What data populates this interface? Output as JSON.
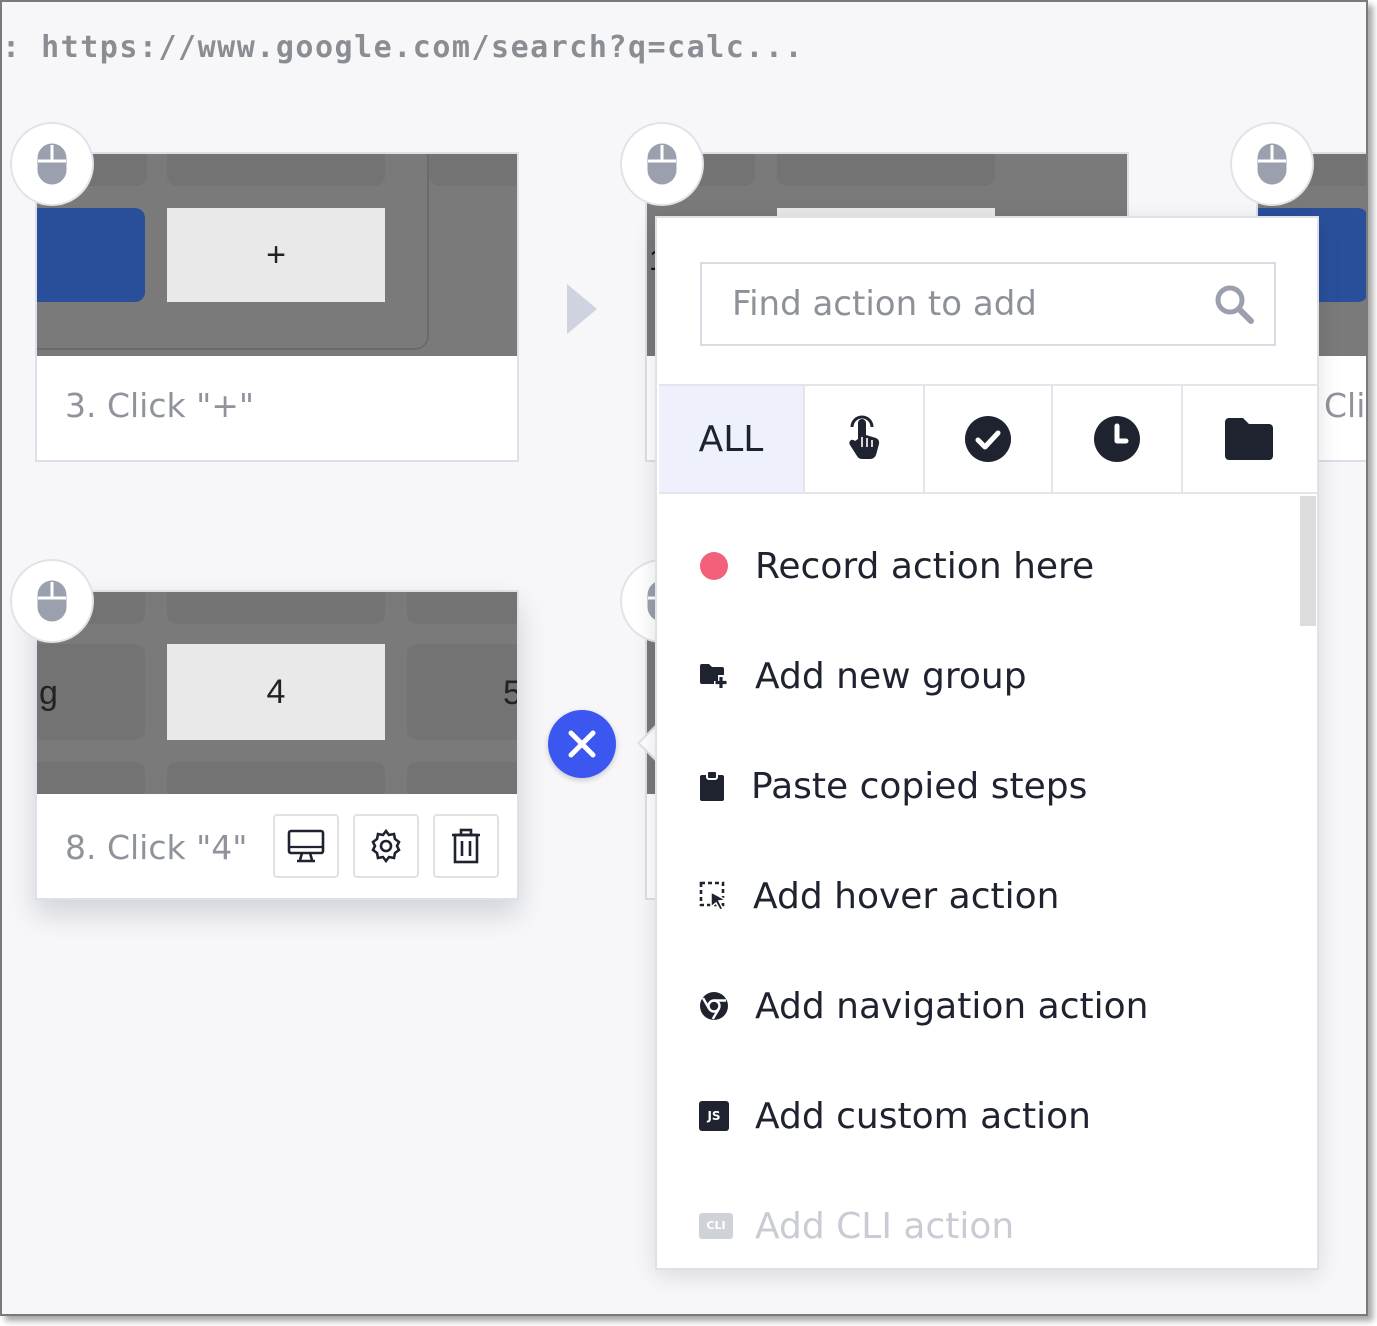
{
  "url_bar": {
    "text": ": https://www.google.com/search?q=calc..."
  },
  "steps": [
    {
      "caption": "3. Click \"+\"",
      "key_label": "+"
    },
    {
      "caption": "8. Click \"4\"",
      "key_label": "4",
      "side_left": "g",
      "side_right": "5"
    }
  ],
  "partial_caption_right": "Cli",
  "partial_key_label": "1",
  "step_tools": {
    "screen": "desktop-icon",
    "settings": "gear-icon",
    "delete": "trash-icon"
  },
  "popup": {
    "search": {
      "placeholder": "Find action to add"
    },
    "tabs": [
      {
        "label": "ALL",
        "selected": true
      },
      {
        "icon": "hand-pointer-icon"
      },
      {
        "icon": "check-circle-icon"
      },
      {
        "icon": "clock-icon"
      },
      {
        "icon": "folder-icon"
      }
    ],
    "actions": [
      {
        "label": "Record action here",
        "icon": "record-dot-icon"
      },
      {
        "label": "Add new group",
        "icon": "folder-plus-icon"
      },
      {
        "label": "Paste copied steps",
        "icon": "clipboard-icon"
      },
      {
        "label": "Add hover action",
        "icon": "hover-cursor-icon"
      },
      {
        "label": "Add navigation action",
        "icon": "chrome-icon"
      },
      {
        "label": "Add custom action",
        "icon": "js-icon",
        "badge": "JS"
      },
      {
        "label": "Add CLI action",
        "icon": "cli-icon",
        "badge": "CLI",
        "disabled": true
      }
    ]
  },
  "colors": {
    "accent": "#3b57f0",
    "record": "#f2607a",
    "text": "#1f2330",
    "muted": "#8f939c",
    "key_blue": "#2a4f9a"
  }
}
